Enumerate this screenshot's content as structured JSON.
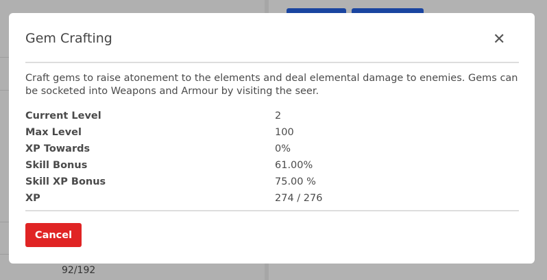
{
  "background": {
    "count_text": "92/192"
  },
  "modal": {
    "title": "Gem Crafting",
    "close_icon": "close-icon",
    "description": "Craft gems to raise atonement to the elements and deal elemental damage to enemies. Gems can be socketed into Weapons and Armour by visiting the seer.",
    "stats": [
      {
        "label": "Current Level",
        "value": "2"
      },
      {
        "label": "Max Level",
        "value": "100"
      },
      {
        "label": "XP Towards",
        "value": "0%"
      },
      {
        "label": "Skill Bonus",
        "value": "61.00%"
      },
      {
        "label": "Skill XP Bonus",
        "value": "75.00 %"
      },
      {
        "label": "XP",
        "value": "274 / 276"
      }
    ],
    "cancel_label": "Cancel",
    "colors": {
      "cancel": "#e02424",
      "bg_button": "#1a45a0"
    }
  }
}
